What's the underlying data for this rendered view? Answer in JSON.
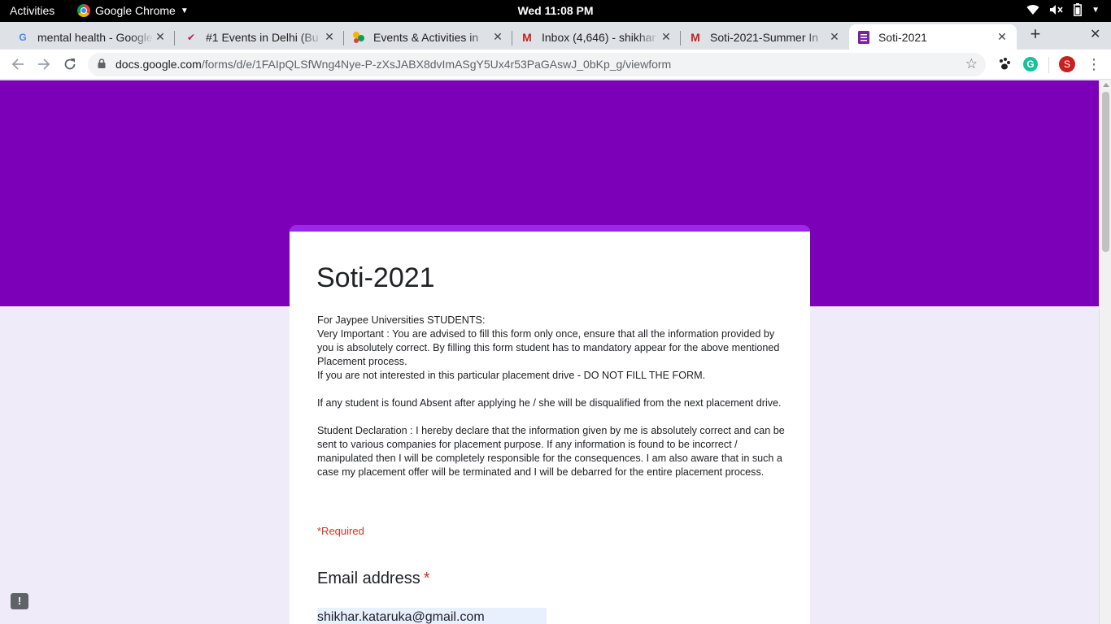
{
  "system": {
    "activities": "Activities",
    "app_name": "Google Chrome",
    "clock": "Wed 11:08 PM",
    "tray_icons": [
      "wifi-icon",
      "volume-muted-icon",
      "battery-icon",
      "power-menu-icon"
    ]
  },
  "tabs": [
    {
      "title": "mental health - Google Search",
      "favicon": "google-g-icon",
      "active": false
    },
    {
      "title": "#1 Events in Delhi (Bu",
      "favicon": "events-logo-icon",
      "active": false
    },
    {
      "title": "Events & Activities in",
      "favicon": "activities-logo-icon",
      "active": false
    },
    {
      "title": "Inbox (4,646) - shikhar",
      "favicon": "gmail-icon",
      "active": false
    },
    {
      "title": "Soti-2021-Summer In",
      "favicon": "gmail-icon",
      "active": false
    },
    {
      "title": "Soti-2021",
      "favicon": "google-forms-icon",
      "active": true
    }
  ],
  "toolbar": {
    "url_host": "docs.google.com",
    "url_path": "/forms/d/e/1FAIpQLSfWng4Nye-P-zXsJABX8dvImASgY5Ux4r53PaGAswJ_0bKp_g/viewform",
    "profile_initial": "S"
  },
  "form": {
    "title": "Soti-2021",
    "description": [
      "For Jaypee Universities STUDENTS:",
      "Very Important : You are advised to fill this form only once, ensure that all the information provided by you is absolutely correct. By filling this form student has to mandatory appear for the above mentioned Placement process.",
      "If you are not interested in this particular placement drive - DO NOT FILL THE FORM.",
      "",
      "If any student is found Absent after applying he / she will be disqualified from the next placement drive.",
      "",
      "Student Declaration : I hereby declare that the information given by me is absolutely correct and can be sent to various companies for placement purpose. If any information is found to be incorrect / manipulated then I will be completely responsible for the consequences. I am also aware that in such a case my placement offer will be terminated and I will be debarred for the entire placement process."
    ],
    "required_note": "*Required",
    "question_label": "Email address",
    "question_required_mark": "*",
    "email_value": "shikhar.kataruka@gmail.com"
  },
  "colors": {
    "banner": "#7b00b8",
    "card_accent": "#9c27e8",
    "page_bg": "#f0ebf8",
    "required": "#d93025"
  }
}
